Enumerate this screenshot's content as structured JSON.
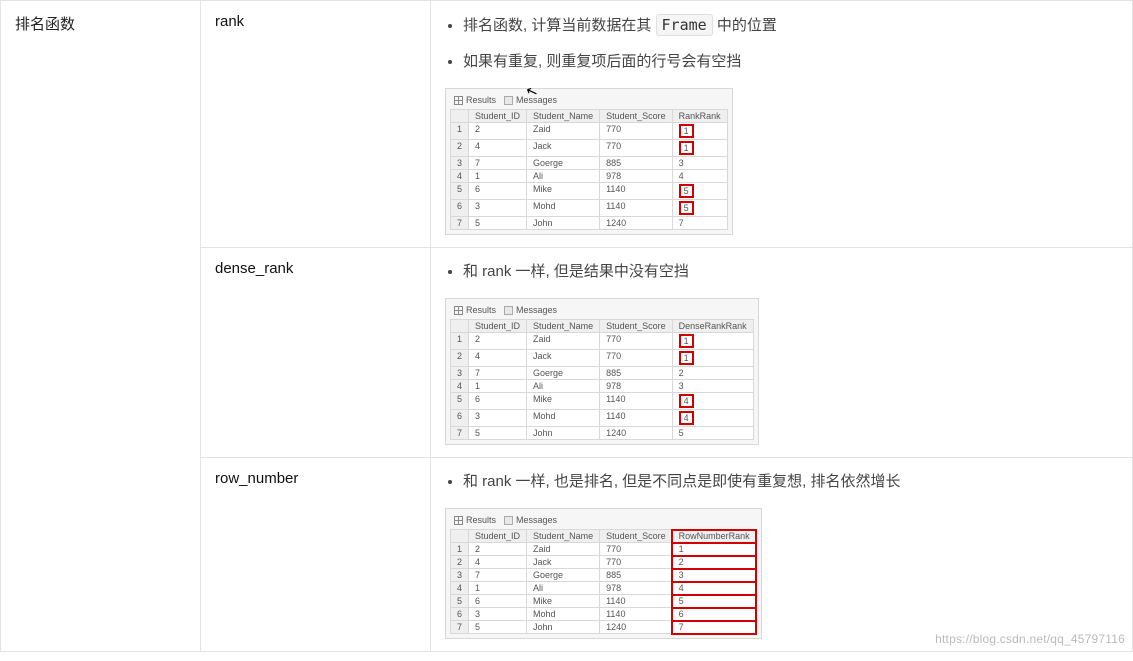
{
  "category": "排名函数",
  "rows": [
    {
      "func": "rank",
      "bullets": [
        {
          "pre": "排名函数, 计算当前数据在其 ",
          "code": "Frame",
          "post": " 中的位置"
        },
        {
          "pre": "如果有重复, 则重复项后面的行号会有空挡",
          "code": "",
          "post": ""
        }
      ],
      "tabs": [
        "Results",
        "Messages"
      ],
      "headers": [
        "Student_ID",
        "Student_Name",
        "Student_Score",
        "RankRank"
      ],
      "table": [
        [
          "1",
          "2",
          "Zaid",
          "770",
          "1"
        ],
        [
          "2",
          "4",
          "Jack",
          "770",
          "1"
        ],
        [
          "3",
          "7",
          "Goerge",
          "885",
          "3"
        ],
        [
          "4",
          "1",
          "Ali",
          "978",
          "4"
        ],
        [
          "5",
          "6",
          "Mike",
          "1140",
          "5"
        ],
        [
          "6",
          "3",
          "Mohd",
          "1140",
          "5"
        ],
        [
          "7",
          "5",
          "John",
          "1240",
          "7"
        ]
      ],
      "hl": "pairs",
      "cursor": true
    },
    {
      "func": "dense_rank",
      "bullets": [
        {
          "pre": "和 rank 一样, 但是结果中没有空挡",
          "code": "",
          "post": ""
        }
      ],
      "tabs": [
        "Results",
        "Messages"
      ],
      "headers": [
        "Student_ID",
        "Student_Name",
        "Student_Score",
        "DenseRankRank"
      ],
      "table": [
        [
          "1",
          "2",
          "Zaid",
          "770",
          "1"
        ],
        [
          "2",
          "4",
          "Jack",
          "770",
          "1"
        ],
        [
          "3",
          "7",
          "Goerge",
          "885",
          "2"
        ],
        [
          "4",
          "1",
          "Ali",
          "978",
          "3"
        ],
        [
          "5",
          "6",
          "Mike",
          "1140",
          "4"
        ],
        [
          "6",
          "3",
          "Mohd",
          "1140",
          "4"
        ],
        [
          "7",
          "5",
          "John",
          "1240",
          "5"
        ]
      ],
      "hl": "pairs"
    },
    {
      "func": "row_number",
      "bullets": [
        {
          "pre": "和 rank 一样, 也是排名, 但是不同点是即使有重复想, 排名依然增长",
          "code": "",
          "post": ""
        }
      ],
      "tabs": [
        "Results",
        "Messages"
      ],
      "headers": [
        "Student_ID",
        "Student_Name",
        "Student_Score",
        "RowNumberRank"
      ],
      "table": [
        [
          "1",
          "2",
          "Zaid",
          "770",
          "1"
        ],
        [
          "2",
          "4",
          "Jack",
          "770",
          "2"
        ],
        [
          "3",
          "7",
          "Goerge",
          "885",
          "3"
        ],
        [
          "4",
          "1",
          "Ali",
          "978",
          "4"
        ],
        [
          "5",
          "6",
          "Mike",
          "1140",
          "5"
        ],
        [
          "6",
          "3",
          "Mohd",
          "1140",
          "6"
        ],
        [
          "7",
          "5",
          "John",
          "1240",
          "7"
        ]
      ],
      "hl": "column"
    }
  ],
  "watermark": "https://blog.csdn.net/qq_45797116"
}
